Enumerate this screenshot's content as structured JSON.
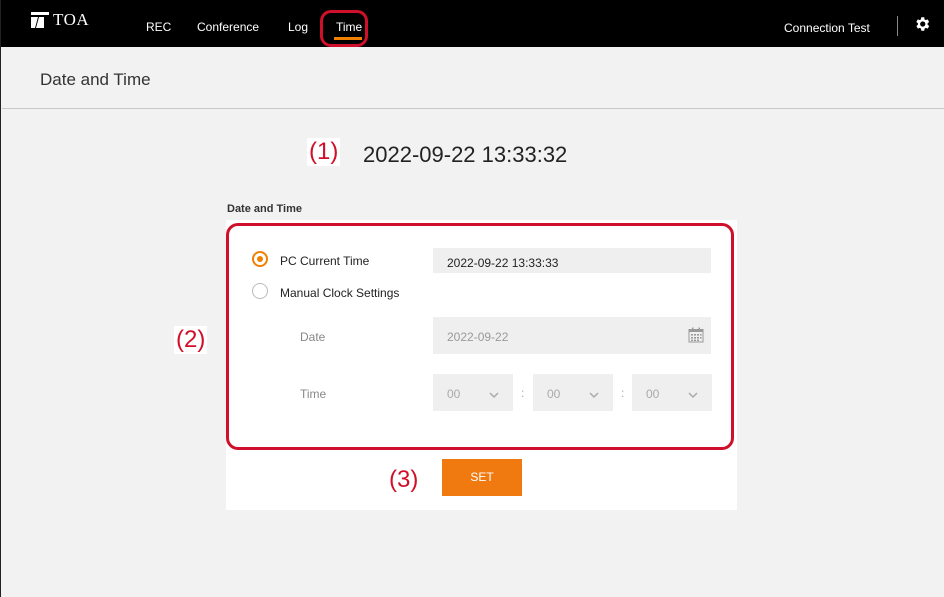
{
  "app": {
    "logo_text": "TOA"
  },
  "nav": {
    "items": [
      {
        "label": "REC"
      },
      {
        "label": "Conference"
      },
      {
        "label": "Log"
      },
      {
        "label": "Time",
        "active": true
      }
    ],
    "connection_test": "Connection Test",
    "accent_color": "#f08000",
    "highlight_color": "#d0102a"
  },
  "page": {
    "title": "Date and Time",
    "current_time": "2022-09-22 13:33:32"
  },
  "annotations": {
    "one": "(1)",
    "two": "(2)",
    "three": "(3)"
  },
  "panel": {
    "label": "Date and Time",
    "pc_current_time": {
      "label": "PC Current Time",
      "value": "2022-09-22 13:33:33",
      "selected": true
    },
    "manual": {
      "label": "Manual Clock Settings",
      "selected": false,
      "date_label": "Date",
      "date_value": "2022-09-22",
      "time_label": "Time",
      "hour": "00",
      "minute": "00",
      "second": "00",
      "separator": ":"
    },
    "set_label": "SET"
  },
  "icons": {
    "gear": "gear-icon",
    "calendar": "calendar-icon",
    "chevron": "chevron-down-icon"
  }
}
